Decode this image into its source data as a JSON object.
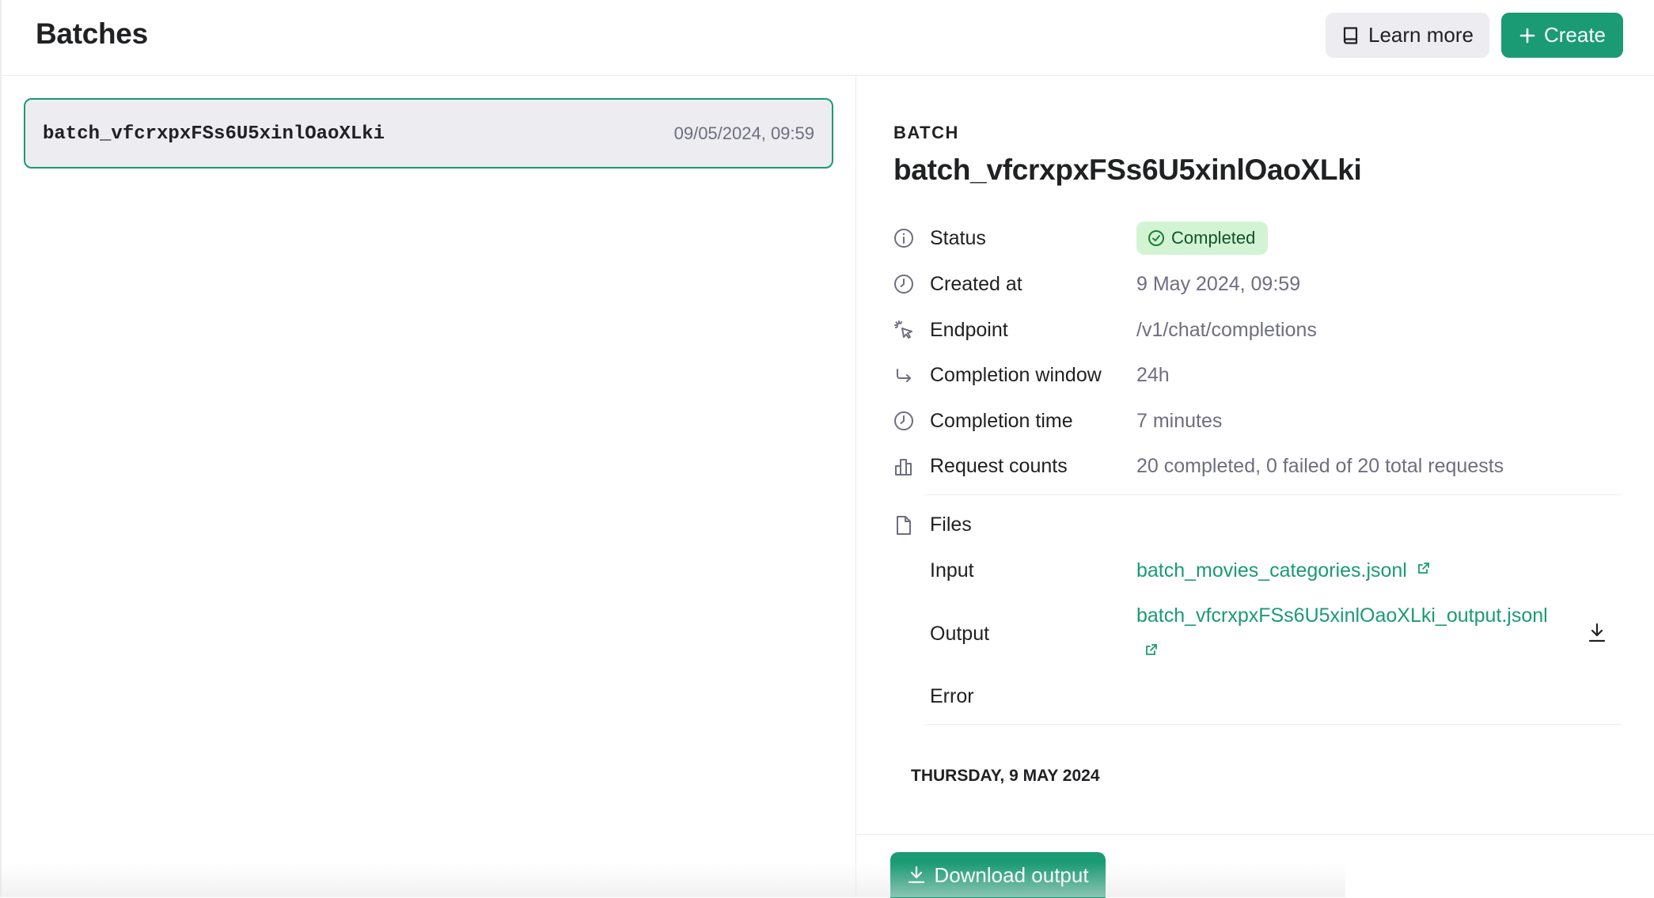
{
  "header": {
    "title": "Batches",
    "learn_more_label": "Learn more",
    "create_label": "Create"
  },
  "batch_list": [
    {
      "id": "batch_vfcrxpxFSs6U5xinlOaoXLki",
      "created": "09/05/2024, 09:59"
    }
  ],
  "detail": {
    "section_label": "BATCH",
    "title": "batch_vfcrxpxFSs6U5xinlOaoXLki",
    "status": {
      "label": "Status",
      "value": "Completed"
    },
    "created_at": {
      "label": "Created at",
      "value": "9 May 2024, 09:59"
    },
    "endpoint": {
      "label": "Endpoint",
      "value": "/v1/chat/completions"
    },
    "completion_window": {
      "label": "Completion window",
      "value": "24h"
    },
    "completion_time": {
      "label": "Completion time",
      "value": "7 minutes"
    },
    "request_counts": {
      "label": "Request counts",
      "value": "20 completed, 0 failed of 20 total requests"
    },
    "files": {
      "label": "Files",
      "input": {
        "label": "Input",
        "value": "batch_movies_categories.jsonl"
      },
      "output": {
        "label": "Output",
        "value": "batch_vfcrxpxFSs6U5xinlOaoXLki_output.jsonl"
      },
      "error": {
        "label": "Error",
        "value": ""
      }
    },
    "date_separator": "THURSDAY, 9 MAY 2024",
    "download_label": "Download output"
  },
  "colors": {
    "accent": "#1a9b73",
    "status_bg": "#d2f4d3",
    "status_fg": "#12512b",
    "muted_text": "#6e6e80"
  }
}
